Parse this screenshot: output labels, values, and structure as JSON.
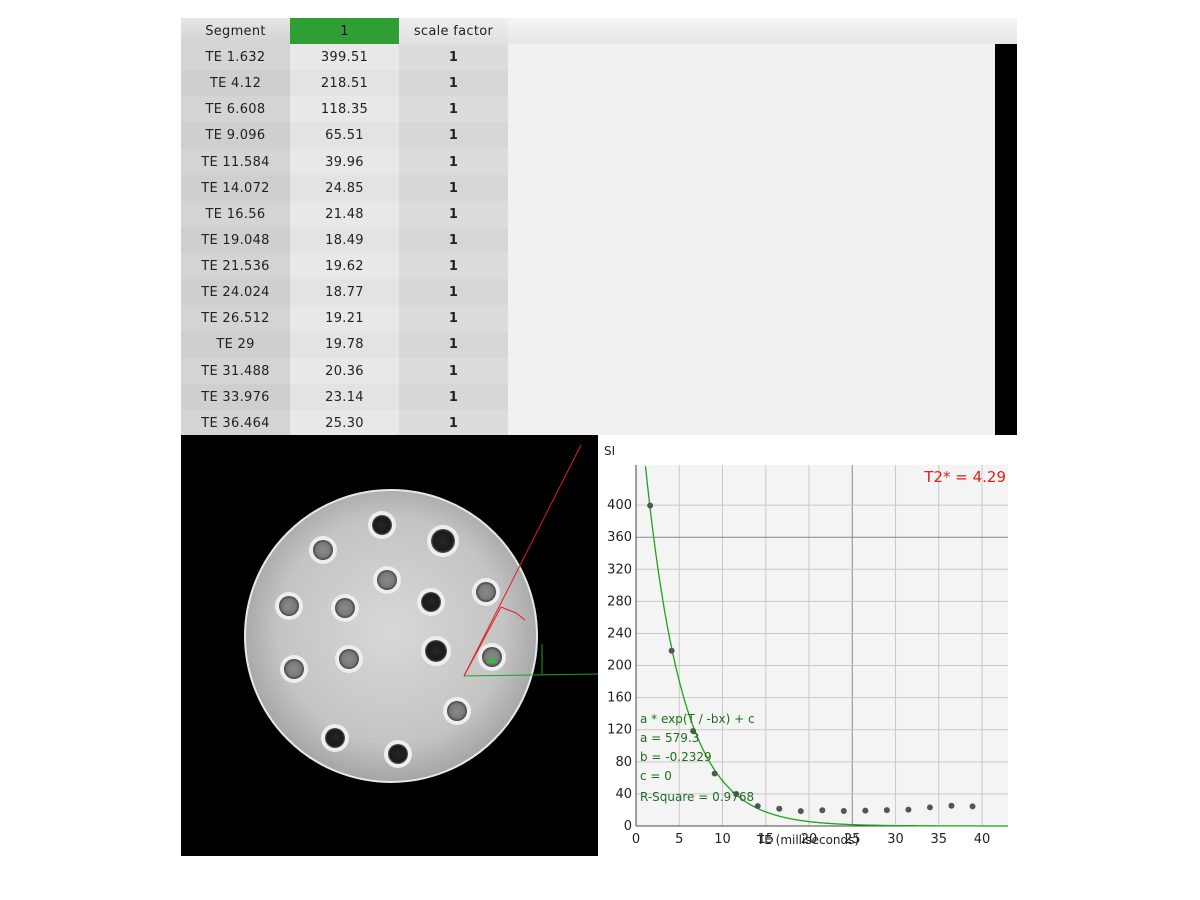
{
  "table": {
    "headers": {
      "segment": "Segment",
      "value": "1",
      "scale": "scale factor"
    },
    "rows": [
      {
        "label": "TE 1.632",
        "value": "399.51",
        "scale": "1"
      },
      {
        "label": "TE 4.12",
        "value": "218.51",
        "scale": "1"
      },
      {
        "label": "TE 6.608",
        "value": "118.35",
        "scale": "1"
      },
      {
        "label": "TE 9.096",
        "value": "65.51",
        "scale": "1"
      },
      {
        "label": "TE 11.584",
        "value": "39.96",
        "scale": "1"
      },
      {
        "label": "TE 14.072",
        "value": "24.85",
        "scale": "1"
      },
      {
        "label": "TE 16.56",
        "value": "21.48",
        "scale": "1"
      },
      {
        "label": "TE 19.048",
        "value": "18.49",
        "scale": "1"
      },
      {
        "label": "TE 21.536",
        "value": "19.62",
        "scale": "1"
      },
      {
        "label": "TE 24.024",
        "value": "18.77",
        "scale": "1"
      },
      {
        "label": "TE 26.512",
        "value": "19.21",
        "scale": "1"
      },
      {
        "label": "TE 29",
        "value": "19.78",
        "scale": "1"
      },
      {
        "label": "TE 31.488",
        "value": "20.36",
        "scale": "1"
      },
      {
        "label": "TE 33.976",
        "value": "23.14",
        "scale": "1"
      },
      {
        "label": "TE 36.464",
        "value": "25.30",
        "scale": "1"
      }
    ]
  },
  "chart_data": {
    "type": "scatter",
    "ylabel": "SI",
    "xlabel": "TE (milliseconds)",
    "xlim": [
      0,
      43
    ],
    "ylim": [
      0,
      450
    ],
    "x_ticks": [
      0,
      5,
      10,
      15,
      20,
      25,
      30,
      35,
      40
    ],
    "y_ticks": [
      0,
      40,
      80,
      120,
      160,
      200,
      240,
      280,
      320,
      360,
      400
    ],
    "grid": true,
    "points": {
      "x": [
        1.632,
        4.12,
        6.608,
        9.096,
        11.584,
        14.072,
        16.56,
        19.048,
        21.536,
        24.024,
        26.512,
        29,
        31.488,
        33.976,
        36.464,
        38.9
      ],
      "y": [
        399.51,
        218.51,
        118.35,
        65.51,
        39.96,
        24.85,
        21.48,
        18.49,
        19.62,
        18.77,
        19.21,
        19.78,
        20.36,
        23.14,
        25.3,
        24.5
      ]
    },
    "fit": {
      "a": 579.3,
      "b": -0.2329,
      "c": 0
    },
    "annotations": {
      "t2star": "T2* = 4.29",
      "equation": "a * exp(T / -bx) + c",
      "a": "a = 579.3",
      "b": "b = -0.2329",
      "c": "c = 0",
      "rsq": "R-Square = 0.9768"
    },
    "colors": {
      "fit": "#1aa51a",
      "points": "#555555",
      "annotation": "#1e6e1e",
      "t2star": "#e02020"
    }
  },
  "viewer": {
    "colors": {
      "roi": "#e02020",
      "marker": "#2fbf3a",
      "profile": "#1aa51a"
    }
  }
}
